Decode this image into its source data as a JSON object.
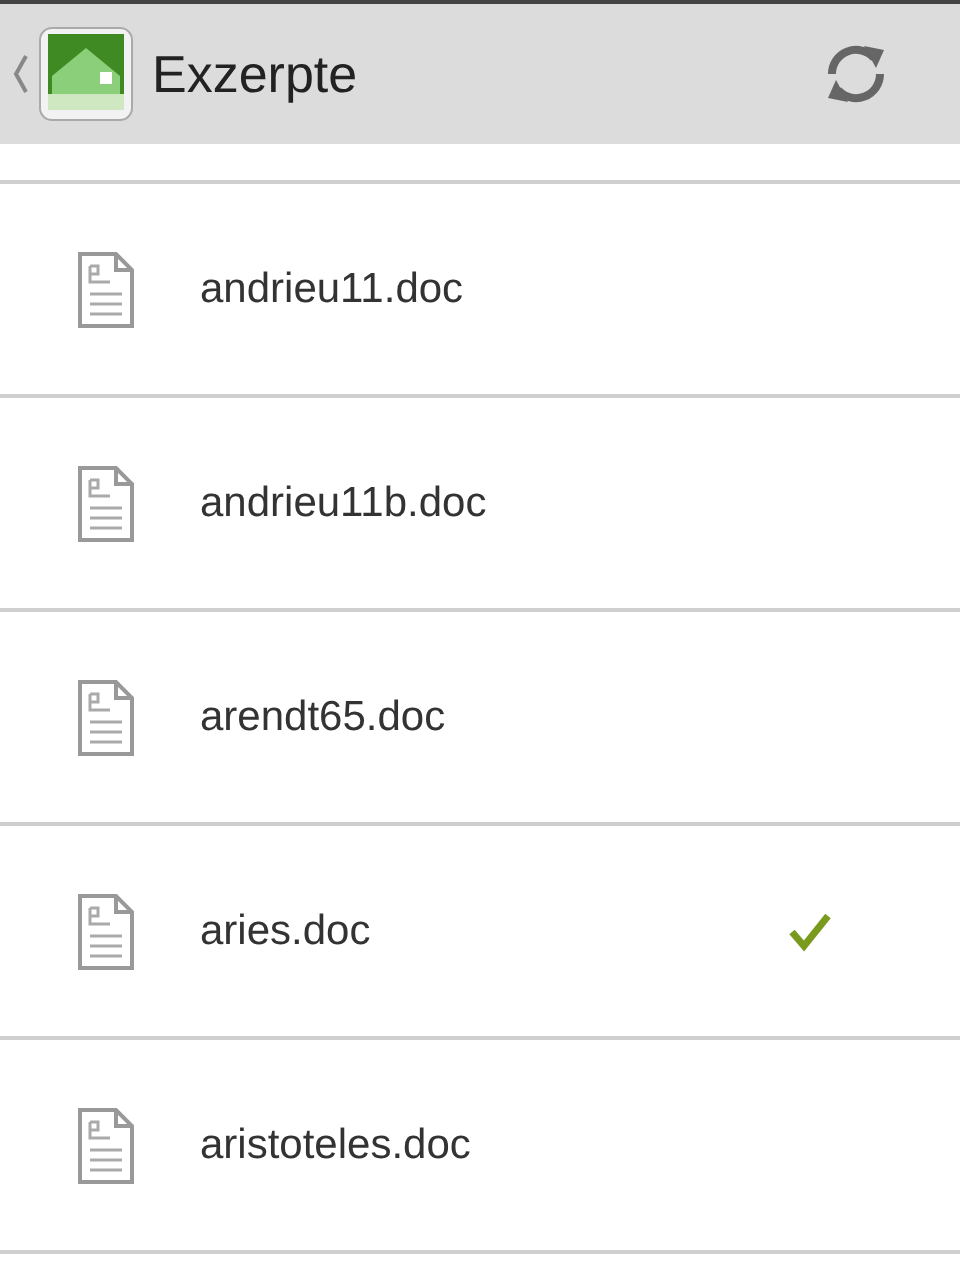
{
  "action_bar": {
    "title": "Exzerpte"
  },
  "files": [
    {
      "name": "andrieu11.doc",
      "checked": false
    },
    {
      "name": "andrieu11b.doc",
      "checked": false
    },
    {
      "name": "arendt65.doc",
      "checked": false
    },
    {
      "name": "aries.doc",
      "checked": true
    },
    {
      "name": "aristoteles.doc",
      "checked": false
    }
  ]
}
